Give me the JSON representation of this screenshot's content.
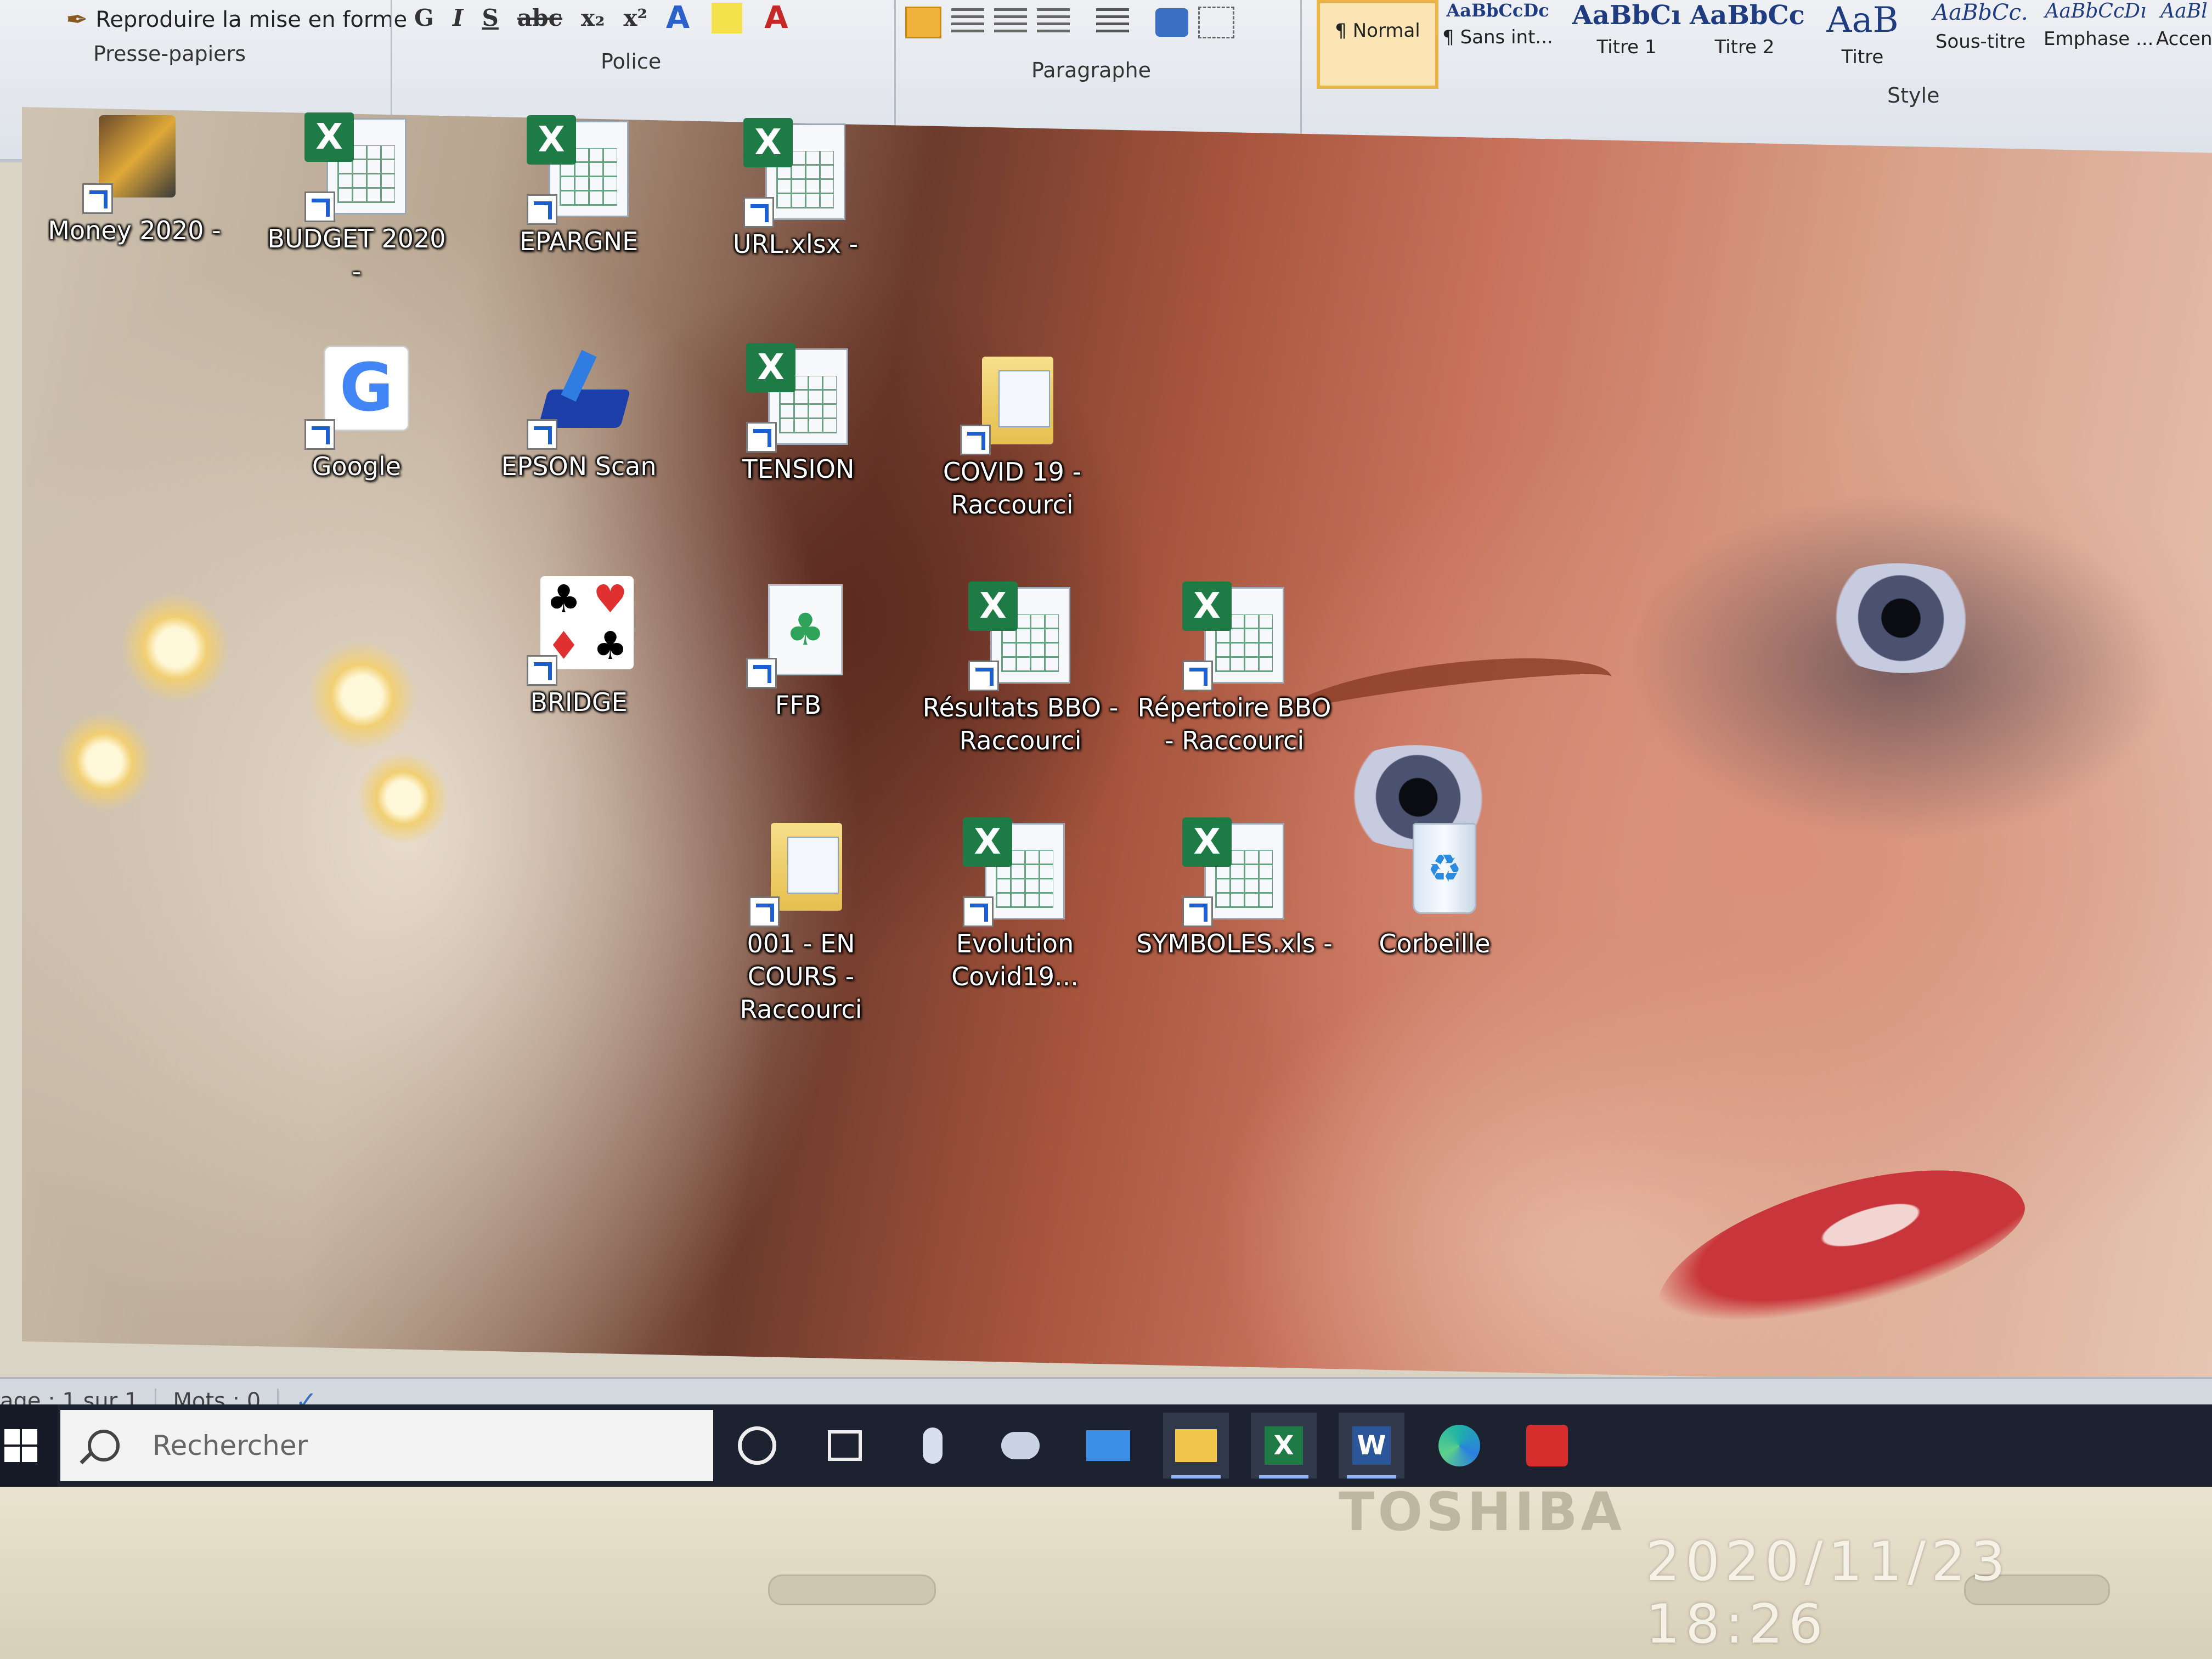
{
  "ribbon": {
    "format_painter": "Reproduire la mise en forme",
    "clipboard_group": "Presse-papiers",
    "font_group": "Police",
    "font_buttons": [
      "G",
      "I",
      "S",
      "abc",
      "x₂",
      "x²"
    ],
    "paragraph_group": "Paragraphe",
    "style_group": "Style",
    "styles": [
      {
        "sample": "",
        "name": "¶ Normal"
      },
      {
        "sample": "AaBbCcDc",
        "name": "¶ Sans int..."
      },
      {
        "sample": "AaBbCı",
        "name": "Titre 1"
      },
      {
        "sample": "AaBbCc",
        "name": "Titre 2"
      },
      {
        "sample": "AaB",
        "name": "Titre"
      },
      {
        "sample": "AaBbCc.",
        "name": "Sous-titre"
      },
      {
        "sample": "AaBbCcDı",
        "name": "Emphase ..."
      },
      {
        "sample": "AaBl",
        "name": "Accen"
      }
    ]
  },
  "desktop": {
    "icons": [
      {
        "label": "Money 2020 -",
        "icon": "money-app-icon"
      },
      {
        "label": "BUDGET 2020 -",
        "icon": "excel-file-icon"
      },
      {
        "label": "EPARGNE",
        "icon": "excel-file-icon"
      },
      {
        "label": "URL.xlsx -",
        "icon": "excel-file-icon"
      },
      {
        "label": "Google",
        "icon": "google-icon"
      },
      {
        "label": "EPSON Scan",
        "icon": "scanner-icon"
      },
      {
        "label": "TENSION",
        "icon": "excel-file-icon"
      },
      {
        "label": "COVID 19 - Raccourci",
        "icon": "folder-icon"
      },
      {
        "label": "BRIDGE",
        "icon": "card-suits-icon"
      },
      {
        "label": "FFB",
        "icon": "ffb-club-icon"
      },
      {
        "label": "Résultats BBO - Raccourci",
        "icon": "excel-file-icon"
      },
      {
        "label": "Répertoire BBO - Raccourci",
        "icon": "excel-file-icon"
      },
      {
        "label": "001 - EN COURS - Raccourci",
        "icon": "folder-icon"
      },
      {
        "label": "Evolution Covid19...",
        "icon": "excel-file-icon"
      },
      {
        "label": "SYMBOLES.xls -",
        "icon": "excel-file-icon"
      },
      {
        "label": "Corbeille",
        "icon": "recycle-bin-icon"
      }
    ]
  },
  "statusbar": {
    "page": "age : 1 sur 1",
    "words": "Mots : 0"
  },
  "taskbar": {
    "search_placeholder": "Rechercher",
    "apps": [
      "cortana-icon",
      "task-view-icon",
      "microphone-icon",
      "photos-icon",
      "mail-icon",
      "file-explorer-icon",
      "excel-icon",
      "word-icon",
      "edge-icon",
      "acrobat-icon"
    ]
  },
  "laptop": {
    "brand": "TOSHIBA",
    "photo_timestamp": "2020/11/23  18:26"
  },
  "colors": {
    "excel_green": "#1e7b45",
    "taskbar": "#1d2230",
    "accent_blue": "#1b5fd1"
  }
}
